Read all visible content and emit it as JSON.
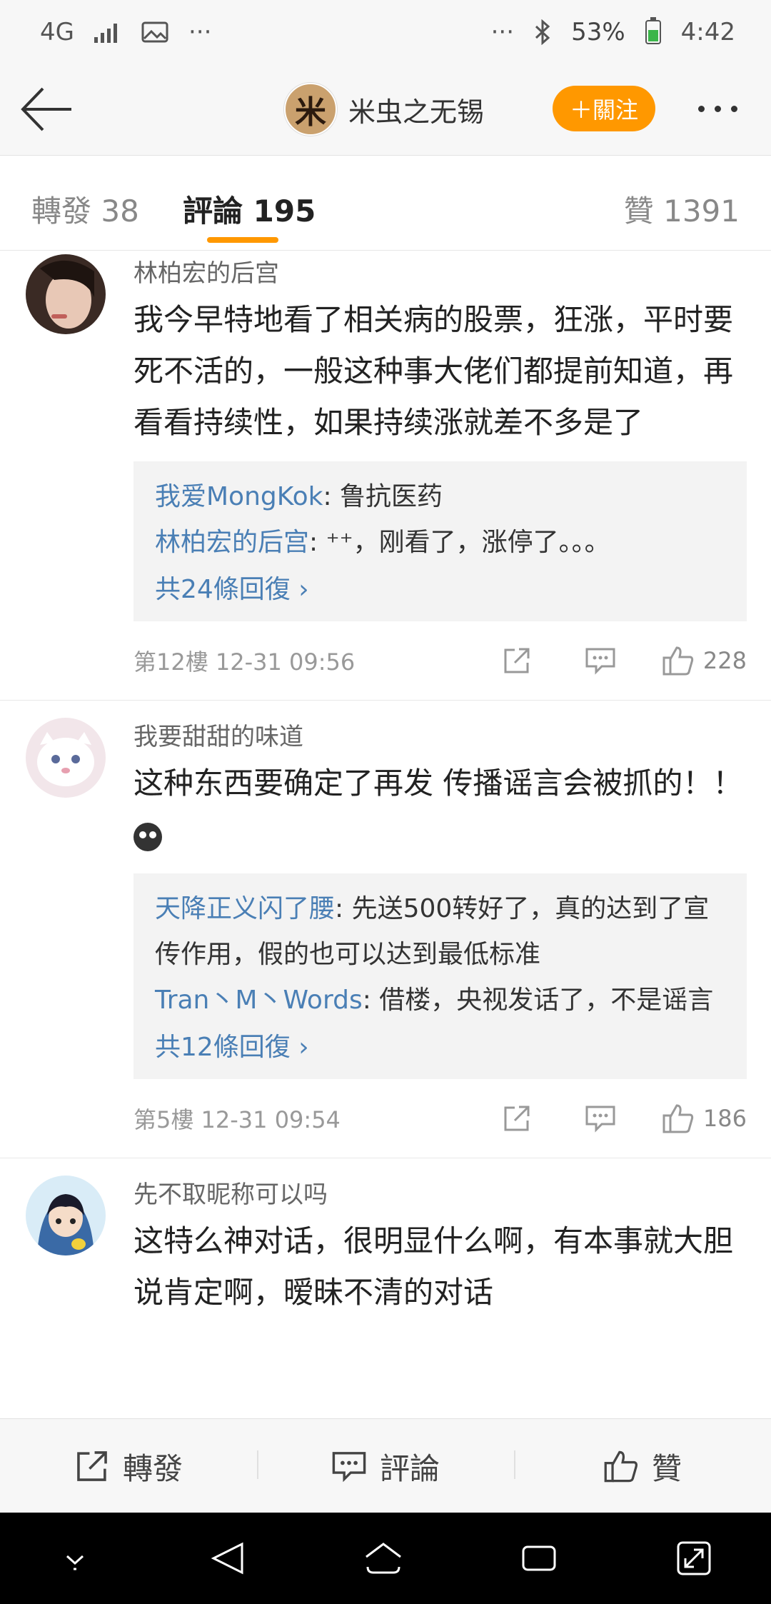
{
  "status_bar": {
    "network": "4G",
    "battery_percent": "53%",
    "battery_level": 0.53,
    "time": "4:42"
  },
  "header": {
    "account_name": "米虫之无锡",
    "avatar_text": "米",
    "follow_label": "＋關注"
  },
  "tabs": [
    {
      "label": "轉發 38"
    },
    {
      "label": "評論 195"
    },
    {
      "label": "贊 1391"
    }
  ],
  "comments": [
    {
      "user": "林柏宏的后宫",
      "text": "我今早特地看了相关病的股票，狂涨，平时要死不活的，一般这种事大佬们都提前知道，再看看持续性，如果持续涨就差不多是了",
      "replies": [
        {
          "name": "我爱MongKok",
          "text": ": 鲁抗医药"
        },
        {
          "name": "林柏宏的后宫",
          "text": ": ⁺⁺，刚看了，涨停了。。。"
        }
      ],
      "more_replies": "共24條回復 ›",
      "floor": "第12樓 12-31 09:56",
      "likes": "228"
    },
    {
      "user": "我要甜甜的味道",
      "text": "这种东西要确定了再发 传播谣言会被抓的！！",
      "replies": [
        {
          "name": "天降正义闪了腰",
          "text": ": 先送500转好了，真的达到了宣传作用，假的也可以达到最低标准"
        },
        {
          "name": "Tran丶M丶Words",
          "text": ": 借楼，央视发话了，不是谣言"
        }
      ],
      "more_replies": "共12條回復 ›",
      "floor": "第5樓 12-31 09:54",
      "likes": "186"
    },
    {
      "user": "先不取昵称可以吗",
      "text": "这特么神对话，很明显什么啊，有本事就大胆说肯定啊，暧昧不清的对话"
    }
  ],
  "bottom_bar": {
    "repost": "轉發",
    "comment": "評論",
    "like": "贊"
  },
  "colors": {
    "accent": "#ff9800",
    "link": "#4a7fb5"
  }
}
